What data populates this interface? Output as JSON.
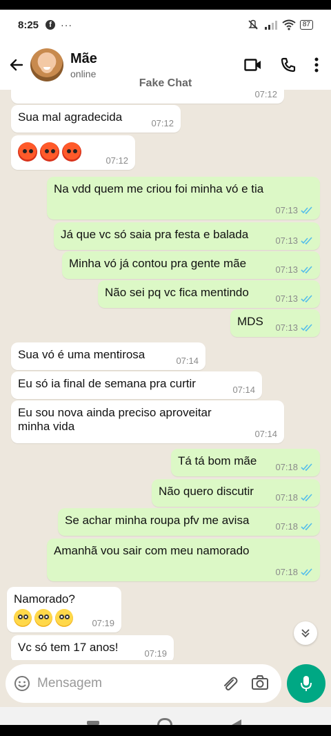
{
  "status": {
    "time": "8:25",
    "fb": "f",
    "dots": "···",
    "battery": "87"
  },
  "header": {
    "name": "Mãe",
    "status": "online"
  },
  "watermark": "Fake Chat",
  "messages": [
    {
      "dir": "in",
      "text": "",
      "time": "07:12"
    },
    {
      "dir": "in",
      "text": "Sua mal agradecida",
      "time": "07:12"
    },
    {
      "dir": "in",
      "text": "",
      "time": "07:12",
      "emoji": "angry-x3"
    },
    {
      "dir": "out",
      "text": "Na vdd quem me criou foi minha vó e tia",
      "time": "07:13"
    },
    {
      "dir": "out",
      "text": "Já que vc só saia pra festa e balada",
      "time": "07:13"
    },
    {
      "dir": "out",
      "text": "Minha vó já contou pra gente mãe",
      "time": "07:13"
    },
    {
      "dir": "out",
      "text": "Não sei pq vc fica mentindo",
      "time": "07:13"
    },
    {
      "dir": "out",
      "text": "MDS",
      "time": "07:13"
    },
    {
      "dir": "in",
      "text": "Sua vó é uma mentirosa",
      "time": "07:14"
    },
    {
      "dir": "in",
      "text": "Eu só ia final de semana pra curtir",
      "time": "07:14"
    },
    {
      "dir": "in",
      "text": "Eu sou nova ainda preciso aproveitar minha vida",
      "time": "07:14"
    },
    {
      "dir": "out",
      "text": "Tá tá bom mãe",
      "time": "07:18"
    },
    {
      "dir": "out",
      "text": "Não quero discutir",
      "time": "07:18"
    },
    {
      "dir": "out",
      "text": "Se achar minha roupa pfv me avisa",
      "time": "07:18"
    },
    {
      "dir": "out",
      "text": "Amanhã vou sair com meu namorado",
      "time": "07:18"
    },
    {
      "dir": "in",
      "text": "Namorado?",
      "time": "07:19",
      "emoji": "flushed-x3"
    },
    {
      "dir": "in",
      "text": "Vc só tem 17 anos!",
      "time": "07:19"
    }
  ],
  "input": {
    "placeholder": "Mensagem"
  },
  "colors": {
    "outgoing": "#dcf8c6",
    "incoming": "#ffffff",
    "accent": "#00a884",
    "tick": "#53bdeb"
  }
}
